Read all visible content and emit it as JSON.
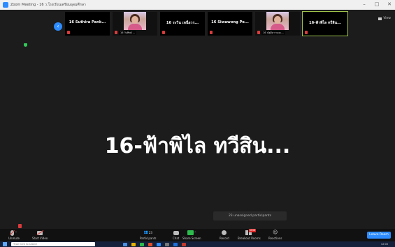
{
  "window": {
    "title": "Zoom Meeting - 16 ว.โรงเรียนเตรียมอุดมศึกษา",
    "controls": [
      "–",
      "□",
      "✕"
    ]
  },
  "gallery_strip": {
    "prev_icon": "chevron-left-icon",
    "tiles": [
      {
        "name": "16 Suthira Pank...",
        "type": "name",
        "mic_muted": true
      },
      {
        "name": "16 วันทิพย์ ...",
        "type": "photo",
        "label": "16 วันทิพย์ ...",
        "mic_muted": true
      },
      {
        "name": "16 ระวิน เหนือวร...",
        "type": "name",
        "mic_muted": true
      },
      {
        "name": "16 Siwawong Pe...",
        "type": "name",
        "mic_muted": true
      },
      {
        "name": "16 ณัฐธิดา ทองแ...",
        "type": "photo",
        "label": "16 ณัฐธิดา ทองแ...",
        "mic_muted": true
      },
      {
        "name": "16-ฟ้าพิไล ทวีสิน...",
        "type": "name",
        "mic_muted": true,
        "active": true
      }
    ]
  },
  "view_button": {
    "label": "View",
    "icon": "grid-icon"
  },
  "main": {
    "speaker_name": "16-ฟ้าพิไล ทวีสิน...",
    "unassigned": "23 unassigned participants"
  },
  "toolbar": {
    "unmute": "Unmute",
    "start_video": "Start Video",
    "participants": "Participants",
    "participants_count": "23",
    "chat": "Chat",
    "share_screen": "Share Screen",
    "record": "Record",
    "breakout_rooms": "Breakout Rooms",
    "breakout_badge": "NEW",
    "reactions": "Reactions",
    "leave": "Leave Room"
  },
  "taskbar": {
    "search_placeholder": "Type here to search",
    "clock": "12:00"
  },
  "colors": {
    "accent": "#2d8cff",
    "share_green": "#2dbb4e",
    "muted_red": "#d93b3b",
    "active_outline": "#9fc34a"
  }
}
